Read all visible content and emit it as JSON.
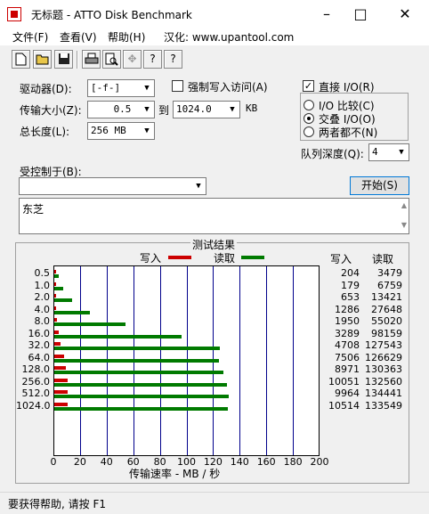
{
  "window": {
    "title": "无标题 - ATTO Disk Benchmark"
  },
  "menu": {
    "file": "文件(F)",
    "view": "查看(V)",
    "help": "帮助(H)",
    "credit": "汉化: www.upantool.com"
  },
  "toolbar": {
    "page_icon": "□",
    "question_mark": "?",
    "help_cursor": "?"
  },
  "settings": {
    "drive_label": "驱动器(D):",
    "drive_value": "[-f-]",
    "transfer_label": "传输大小(Z):",
    "transfer_from": "0.5",
    "to_label": "到",
    "transfer_to": "1024.0",
    "kb_unit": "KB",
    "total_label": "总长度(L):",
    "total_value": "256 MB",
    "force_write_label": "强制写入访问(A)",
    "direct_io_label": "直接 I/O(R)",
    "direct_io_checked": "✓",
    "io_compare_label": "I/O 比较(C)",
    "overlapped_io_label": "交叠 I/O(O)",
    "neither_label": "两者都不(N)",
    "queue_label": "队列深度(Q):",
    "queue_value": "4",
    "controlled_by_label": "受控制于(B):",
    "start_button": "开始(S)",
    "description": "东芝"
  },
  "results": {
    "section_title": "测试结果",
    "write_legend": "写入",
    "read_legend": "读取",
    "write_header": "写入",
    "read_header": "读取",
    "x_axis_label": "传输速率 - MB / 秒",
    "write_color": "#cc0000",
    "read_color": "#007a00"
  },
  "chart_data": {
    "type": "bar",
    "orientation": "horizontal",
    "title": "测试结果",
    "xlabel": "传输速率 - MB / 秒",
    "xlim": [
      0,
      200
    ],
    "x_ticks": [
      "0",
      "20",
      "40",
      "60",
      "80",
      "100",
      "120",
      "140",
      "160",
      "180",
      "200"
    ],
    "categories": [
      "0.5",
      "1.0",
      "2.0",
      "4.0",
      "8.0",
      "16.0",
      "32.0",
      "64.0",
      "128.0",
      "256.0",
      "512.0",
      "1024.0"
    ],
    "series": [
      {
        "name": "写入",
        "values_kb": [
          "204",
          "179",
          "653",
          "1286",
          "1950",
          "3289",
          "4708",
          "7506",
          "8971",
          "10051",
          "9964",
          "10514"
        ]
      },
      {
        "name": "读取",
        "values_kb": [
          "3479",
          "6759",
          "13421",
          "27648",
          "55020",
          "98159",
          "127543",
          "126629",
          "130363",
          "132560",
          "134441",
          "133549"
        ]
      }
    ]
  },
  "status": {
    "text": "要获得帮助, 请按 F1"
  }
}
